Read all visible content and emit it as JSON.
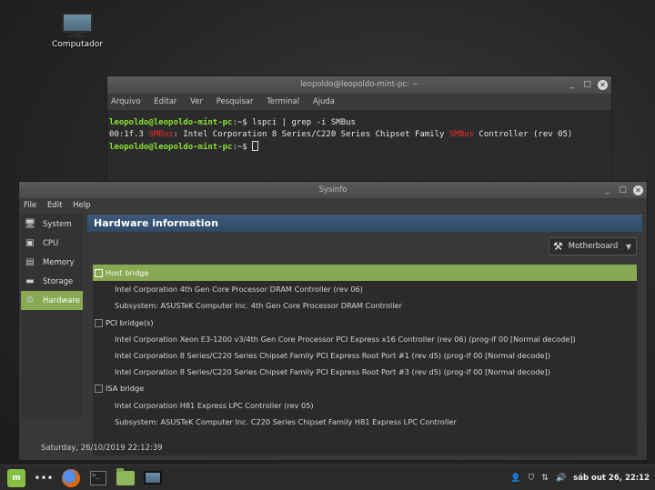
{
  "desktop": {
    "icon_label": "Computador"
  },
  "terminal": {
    "title": "leopoldo@leopoldo-mint-pc: ~",
    "menu": [
      "Arquivo",
      "Editar",
      "Ver",
      "Pesquisar",
      "Terminal",
      "Ajuda"
    ],
    "line1_prompt": "leopoldo@leopoldo-mint-pc",
    "line1_sep": ":~$ ",
    "line1_cmd": "lspci | grep -i SMBus",
    "line2_pre": "00:1f.3 ",
    "line2_hl1": "SMBus",
    "line2_mid": ": Intel Corporation 8 Series/C220 Series Chipset Family ",
    "line2_hl2": "SMBus",
    "line2_post": " Controller (rev 05)",
    "line3_prompt": "leopoldo@leopoldo-mint-pc",
    "line3_sep": ":~$ "
  },
  "sysinfo": {
    "title": "Sysinfo",
    "menu": [
      "File",
      "Edit",
      "Help"
    ],
    "sidebar": [
      "System",
      "CPU",
      "Memory",
      "Storage",
      "Hardware"
    ],
    "header": "Hardware information",
    "dropdown": "Motherboard",
    "tree": [
      {
        "type": "group",
        "text": "Host bridge",
        "selected": true
      },
      {
        "type": "child",
        "text": "Intel Corporation 4th Gen Core Processor DRAM Controller (rev 06)"
      },
      {
        "type": "child",
        "text": "Subsystem: ASUSTeK Computer Inc. 4th Gen Core Processor DRAM Controller"
      },
      {
        "type": "group",
        "text": "PCI bridge(s)"
      },
      {
        "type": "child",
        "text": "Intel Corporation Xeon E3-1200 v3/4th Gen Core Processor PCI Express x16 Controller (rev 06) (prog-if 00 [Normal decode])"
      },
      {
        "type": "child",
        "text": "Intel Corporation 8 Series/C220 Series Chipset Family PCI Express Root Port #1 (rev d5) (prog-if 00 [Normal decode])"
      },
      {
        "type": "child",
        "text": "Intel Corporation 8 Series/C220 Series Chipset Family PCI Express Root Port #3 (rev d5) (prog-if 00 [Normal decode])"
      },
      {
        "type": "group",
        "text": "ISA bridge"
      },
      {
        "type": "child",
        "text": "Intel Corporation H81 Express LPC Controller (rev 05)"
      },
      {
        "type": "child",
        "text": "Subsystem: ASUSTeK Computer Inc. C220 Series Chipset Family H81 Express LPC Controller"
      }
    ],
    "status": "Saturday, 26/10/2019 22:12:39"
  },
  "taskbar": {
    "clock": "sáb out 26, 22:12"
  },
  "colors": {
    "accent": "#86a952",
    "header": "#2f4a68",
    "prompt": "#8ae234",
    "highlight": "#ef2929"
  }
}
